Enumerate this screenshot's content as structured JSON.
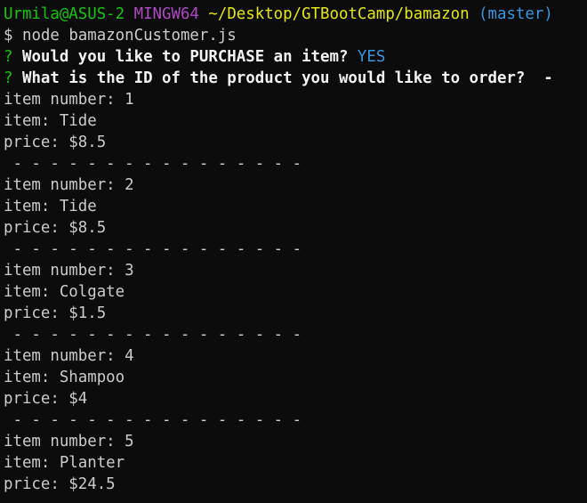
{
  "prompt": {
    "user_host": "Urmila@ASUS-2",
    "system": "MINGW64",
    "path": "~/Desktop/GTBootCamp/bamazon",
    "branch": "(master)",
    "symbol": "$",
    "command": "node bamazonCustomer.js"
  },
  "colors": {
    "background": "#0c0c0c",
    "text": "#cccccc",
    "user_host": "#16c60c",
    "system": "#b148c6",
    "path": "#e5e510",
    "branch": "#3a96dd",
    "question_mark": "#16c60c",
    "answer": "#3a96dd"
  },
  "questions": [
    {
      "mark": "?",
      "text": "Would you like to PURCHASE an item?",
      "answer": "YES"
    },
    {
      "mark": "?",
      "text": "What is the ID of the product you would like to order?  -",
      "answer": ""
    }
  ],
  "separator": " - - - - - - - - - - - - - - - -",
  "items": [
    {
      "number_label": "item number: 1",
      "item_label": "item: Tide",
      "price_label": "price: $8.5"
    },
    {
      "number_label": "item number: 2",
      "item_label": "item: Tide",
      "price_label": "price: $8.5"
    },
    {
      "number_label": "item number: 3",
      "item_label": "item: Colgate",
      "price_label": "price: $1.5"
    },
    {
      "number_label": "item number: 4",
      "item_label": "item: Shampoo",
      "price_label": "price: $4"
    },
    {
      "number_label": "item number: 5",
      "item_label": "item: Planter",
      "price_label": "price: $24.5"
    }
  ]
}
